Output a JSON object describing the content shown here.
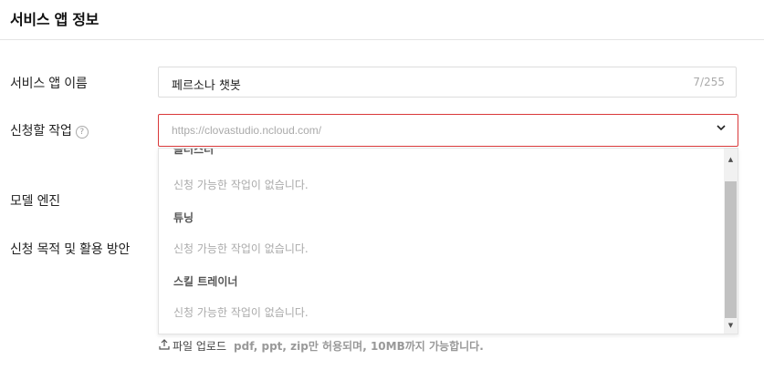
{
  "section": {
    "title": "서비스 앱 정보"
  },
  "fields": {
    "app_name": {
      "label": "서비스 앱 이름",
      "value": "페르소나 챗봇",
      "counter": "7/255"
    },
    "task": {
      "label": "신청할 작업",
      "help_glyph": "?",
      "placeholder": "https://clovastudio.ncloud.com/"
    },
    "model_engine": {
      "label": "모델 엔진"
    },
    "purpose": {
      "label": "신청 목적 및 활용 방안"
    }
  },
  "dropdown": {
    "partial_group": "클러스터",
    "groups": [
      {
        "empty_text": "신청 가능한 작업이 없습니다."
      },
      {
        "label": "튜닝",
        "empty_text": "신청 가능한 작업이 없습니다."
      },
      {
        "label": "스킬 트레이너",
        "empty_text": "신청 가능한 작업이 없습니다."
      }
    ]
  },
  "upload": {
    "label": "파일 업로드",
    "hint": "pdf, ppt, zip만 허용되며, 10MB까지 가능합니다."
  },
  "icons": {
    "chevron": "chevron-down-icon",
    "help": "help-circle-icon",
    "upload": "upload-icon"
  },
  "colors": {
    "error_border": "#d9383a",
    "placeholder": "#aaaaaa"
  }
}
